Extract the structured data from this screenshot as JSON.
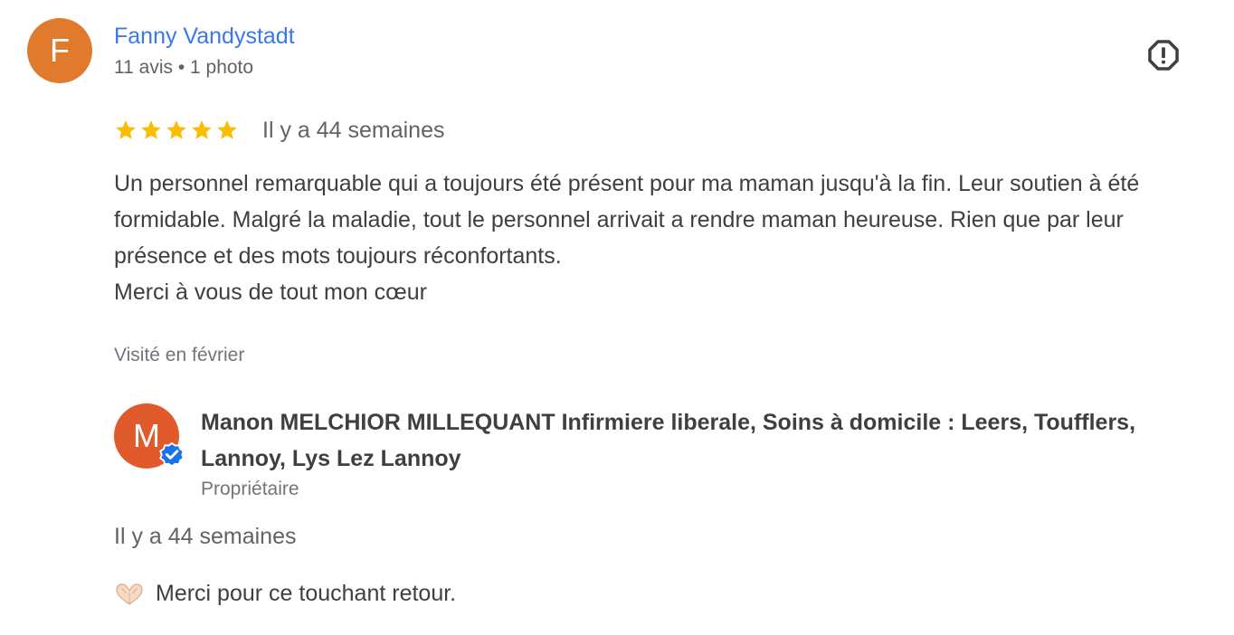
{
  "review": {
    "reviewer": {
      "initial": "F",
      "name": "Fanny Vandystadt",
      "meta": "11 avis • 1 photo",
      "avatar_color": "#e07b2d"
    },
    "report_icon": "report-flag-icon",
    "rating": {
      "stars": 5,
      "max": 5,
      "star_color": "#fbbc04"
    },
    "date": "Il y a 44 semaines",
    "text": [
      "Un personnel remarquable qui a toujours été présent pour ma maman jusqu'à la fin. Leur soutien à été formidable. Malgré la maladie, tout le personnel arrivait a rendre maman heureuse. Rien que par leur présence et des mots toujours réconfortants.",
      "Merci à vous de tout mon cœur"
    ],
    "visited": "Visité en février"
  },
  "owner_reply": {
    "initial": "M",
    "avatar_color": "#e05a2b",
    "badge_icon": "verified-check-icon",
    "name": "Manon MELCHIOR MILLEQUANT Infirmiere liberale, Soins à domicile : Leers, Toufflers, Lannoy, Lys Lez Lannoy",
    "role": "Propriétaire",
    "date": "Il y a 44 semaines",
    "emoji_icon": "heart-hands-icon",
    "text": "Merci pour ce touchant retour."
  },
  "colors": {
    "link_blue": "#3b78e7",
    "text_primary": "#3c4043",
    "text_secondary": "#5f6368",
    "verified_blue": "#1a73e8"
  }
}
